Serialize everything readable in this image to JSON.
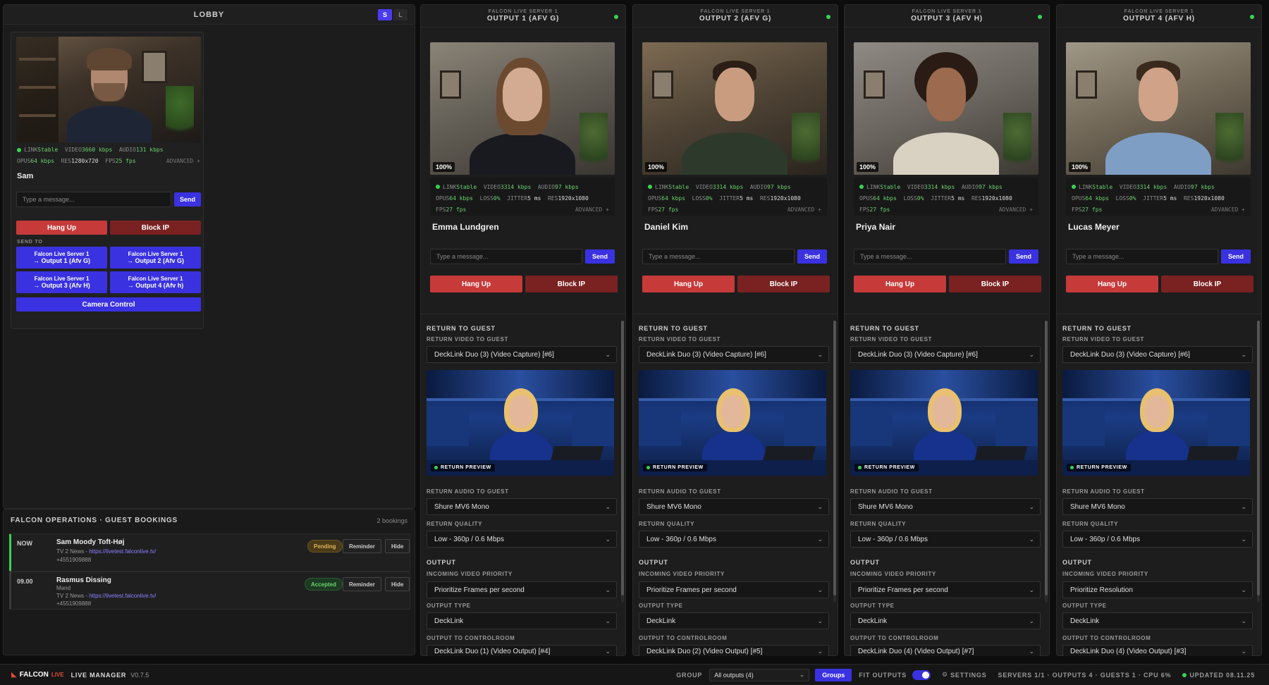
{
  "lobby": {
    "title": "LOBBY",
    "size_small": "S",
    "size_large": "L",
    "guest": {
      "name": "Sam",
      "stats_line1": {
        "link_label": "LINK",
        "link_value": "Stable",
        "video_label": "VIDEO",
        "video_value": "3660 kbps",
        "audio_label": "AUDIO",
        "audio_value": "131 kbps"
      },
      "stats_line2": {
        "opus_label": "OPUS",
        "opus_value": "64 kbps",
        "res_label": "RES",
        "res_value": "1280x720",
        "fps_label": "FPS",
        "fps_value": "25 fps"
      },
      "advanced": "ADVANCED +",
      "message_placeholder": "Type a message...",
      "send": "Send",
      "hang_up": "Hang Up",
      "block_ip": "Block IP",
      "send_to_label": "SEND TO",
      "send_targets": [
        {
          "line1": "Falcon Live Server 1",
          "line2": "→ Output 1 (Afv G)"
        },
        {
          "line1": "Falcon Live Server 1",
          "line2": "→ Output 2 (Afv G)"
        },
        {
          "line1": "Falcon Live Server 1",
          "line2": "→ Output 3 (Afv H)"
        },
        {
          "line1": "Falcon Live Server 1",
          "line2": "→ Output 4 (Afv h)"
        }
      ],
      "camera_control": "Camera Control"
    }
  },
  "bookings": {
    "title": "FALCON OPERATIONS · GUEST BOOKINGS",
    "count": "2 bookings",
    "rows": [
      {
        "time": "NOW",
        "name": "Sam Moody Toft-Høj",
        "org": "TV 2 News - ",
        "link": "https://livetest.falconlive.tv/",
        "phone": "+4551909888",
        "status": "Pending",
        "reminder": "Reminder",
        "hide": "Hide"
      },
      {
        "time": "09.00",
        "name": "Rasmus Dissing",
        "role": "Mand",
        "org": "TV 2 News - ",
        "link": "https://livetest.falconlive.tv/",
        "phone": "+4551909888",
        "status": "Accepted",
        "reminder": "Reminder",
        "hide": "Hide"
      }
    ]
  },
  "outputs": [
    {
      "server": "FALCON LIVE SERVER 1",
      "name": "OUTPUT 1 (AFV G)",
      "guest": "Emma Lundgren",
      "pct": "100%",
      "return_video": "DeckLink Duo (3) (Video Capture) [#6]",
      "return_audio": "Shure MV6 Mono",
      "return_quality": "Low - 360p / 0.6 Mbps",
      "video_priority": "Prioritize Frames per second",
      "output_type": "DeckLink",
      "controlroom": "DeckLink Duo (1) (Video Output) [#4]"
    },
    {
      "server": "FALCON LIVE SERVER 1",
      "name": "OUTPUT 2 (AFV G)",
      "guest": "Daniel Kim",
      "pct": "100%",
      "return_video": "DeckLink Duo (3) (Video Capture) [#6]",
      "return_audio": "Shure MV6 Mono",
      "return_quality": "Low - 360p / 0.6 Mbps",
      "video_priority": "Prioritize Frames per second",
      "output_type": "DeckLink",
      "controlroom": "DeckLink Duo (2) (Video Output) [#5]"
    },
    {
      "server": "FALCON LIVE SERVER 1",
      "name": "OUTPUT 3 (AFV H)",
      "guest": "Priya Nair",
      "pct": "100%",
      "return_video": "DeckLink Duo (3) (Video Capture) [#6]",
      "return_audio": "Shure MV6 Mono",
      "return_quality": "Low - 360p / 0.6 Mbps",
      "video_priority": "Prioritize Frames per second",
      "output_type": "DeckLink",
      "controlroom": "DeckLink Duo (4) (Video Output) [#7]"
    },
    {
      "server": "FALCON LIVE SERVER 1",
      "name": "OUTPUT 4 (AFV H)",
      "guest": "Lucas Meyer",
      "pct": "100%",
      "return_video": "DeckLink Duo (3) (Video Capture) [#6]",
      "return_audio": "Shure MV6 Mono",
      "return_quality": "Low - 360p / 0.6 Mbps",
      "video_priority": "Prioritize Resolution",
      "output_type": "DeckLink",
      "controlroom": "DeckLink Duo (4) (Video Output) [#3]"
    }
  ],
  "output_common": {
    "stats1": {
      "link_label": "LINK",
      "link_value": "Stable",
      "video_label": "VIDEO",
      "video_value": "3314 kbps",
      "audio_label": "AUDIO",
      "audio_value": "97 kbps"
    },
    "stats2": {
      "opus_label": "OPUS",
      "opus_value": "64 kbps",
      "loss_label": "LOSS",
      "loss_value": "0%",
      "jitter_label": "JITTER",
      "jitter_value": "5 ms",
      "res_label": "RES",
      "res_value": "1920x1080"
    },
    "stats3": {
      "fps_label": "FPS",
      "fps_value": "27 fps"
    },
    "advanced": "ADVANCED +",
    "message_placeholder": "Type a message...",
    "send": "Send",
    "hang_up": "Hang Up",
    "block_ip": "Block IP",
    "return_to_guest": "RETURN TO GUEST",
    "return_video_label": "RETURN VIDEO TO GUEST",
    "return_preview": "RETURN PREVIEW",
    "return_audio_label": "RETURN AUDIO TO GUEST",
    "return_quality_label": "RETURN QUALITY",
    "output": "OUTPUT",
    "video_priority_label": "INCOMING VIDEO PRIORITY",
    "output_type_label": "OUTPUT TYPE",
    "controlroom_label": "OUTPUT TO CONTROLROOM"
  },
  "footer": {
    "brand": "FALCON",
    "brand_tag": "LIVE",
    "app": "LIVE MANAGER",
    "version": "V0.7.5",
    "group_label": "GROUP",
    "group_value": "All outputs (4)",
    "groups_btn": "Groups",
    "fit_outputs": "FIT OUTPUTS",
    "settings": "SETTINGS",
    "summary": "SERVERS 1/1 · OUTPUTS 4 · GUESTS 1 · CPU 6%",
    "updated": "UPDATED 08.11.25"
  },
  "colors": {
    "accent": "#3a32e0",
    "danger": "#c73a3a",
    "danger_dark": "#7a2222",
    "ok": "#39d353"
  }
}
